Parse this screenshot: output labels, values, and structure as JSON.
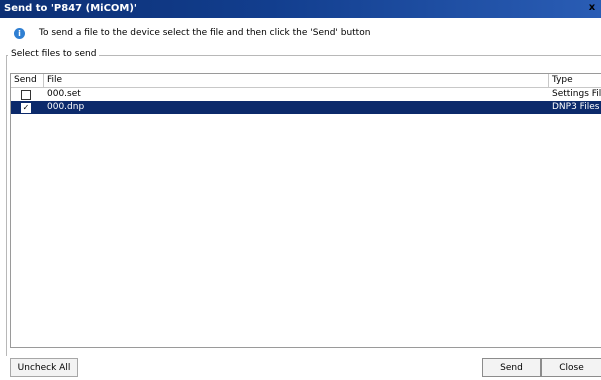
{
  "window": {
    "title": "Send to 'P847 (MiCOM)'",
    "close_glyph": "x",
    "title_bar_color": "#123e8e"
  },
  "info": {
    "icon": "info-icon",
    "icon_glyph": "i",
    "text": "To send a file to the device select the file and then click the 'Send' button"
  },
  "group": {
    "label": "Select files to send"
  },
  "table": {
    "columns": [
      "Send",
      "File",
      "Type"
    ],
    "rows": [
      {
        "checked": false,
        "check_glyph": "",
        "file": "000.set",
        "type": "Settings Files"
      },
      {
        "checked": true,
        "check_glyph": "✓",
        "file": "000.dnp",
        "type": "DNP3 Files"
      }
    ],
    "selected_row_color": "#0c2a6b"
  },
  "buttons": {
    "uncheck_all": "Uncheck All",
    "send": "Send",
    "close": "Close"
  }
}
